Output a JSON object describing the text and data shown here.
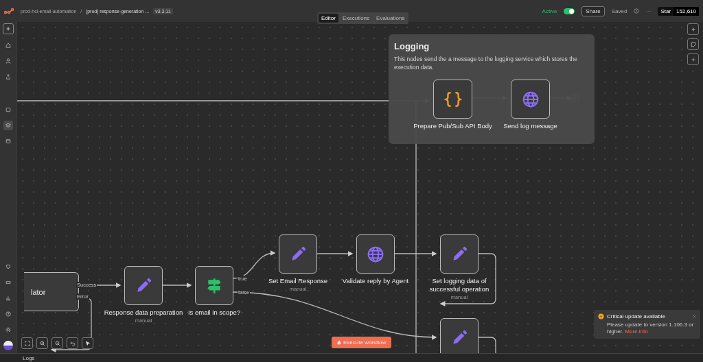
{
  "top_bar": {
    "project": "prod-hcl-email-automation",
    "separator": "/",
    "workflow": "[prod] response-generation ...",
    "version": "v3.3.11",
    "active_label": "Active",
    "active": true,
    "share": "Share",
    "saved": "Saved",
    "more": "···",
    "github_label": "Star",
    "github_count": "152,610"
  },
  "tabs": [
    {
      "label": "Editor",
      "selected": true
    },
    {
      "label": "Executions",
      "selected": false
    },
    {
      "label": "Evaluations",
      "selected": false
    }
  ],
  "sticky": {
    "title": "Logging",
    "text": "This nodes send the a message to the logging service which stores the execution data."
  },
  "nodes": [
    {
      "kind": "plain",
      "label": "lator",
      "outputs": [
        "Success",
        "Error"
      ]
    },
    {
      "kind": "braces",
      "label": "Prepare Pub/Sub API Body"
    },
    {
      "kind": "globe",
      "label": "Send log message"
    },
    {
      "kind": "pencil",
      "label": "Response data preparation",
      "subtitle": "manual"
    },
    {
      "kind": "switch",
      "label": "Is email in scope?",
      "outputs": [
        "true",
        "false"
      ]
    },
    {
      "kind": "pencil",
      "label": "Set Email Response",
      "subtitle": "manual"
    },
    {
      "kind": "globe",
      "label": "Validate reply by Agent"
    },
    {
      "kind": "pencil",
      "label": "Set logging data of successful operation",
      "subtitle": "manual"
    },
    {
      "kind": "pencil"
    }
  ],
  "execute_button": "Execute workflow",
  "toast": {
    "title": "Critical update available",
    "text": "Please update to version 1.106.3 or higher.",
    "link": "More info"
  },
  "logs": "Logs"
}
